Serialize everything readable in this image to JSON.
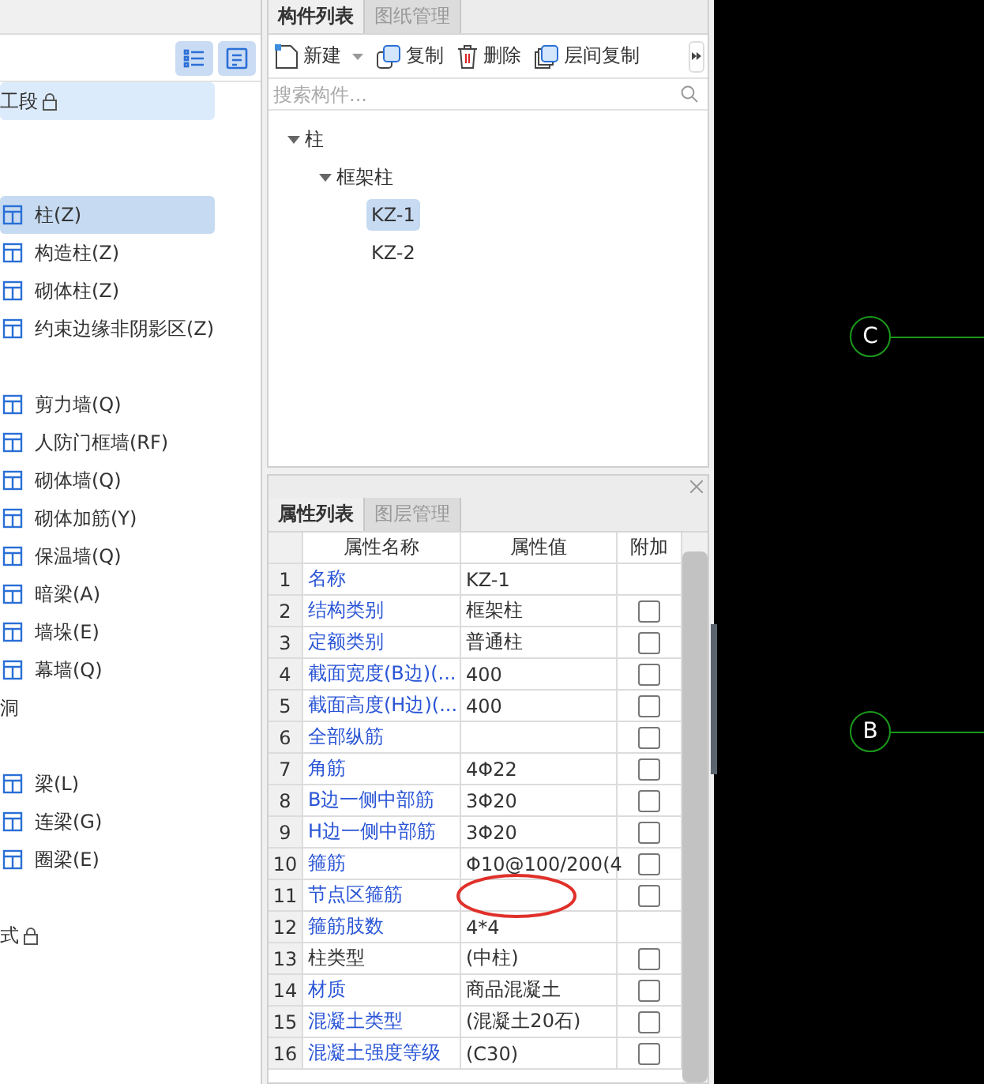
{
  "left": {
    "groups": [
      {
        "header": "工段",
        "locked": true,
        "selected": true
      },
      {
        "items": [
          {
            "label": "柱(Z)",
            "selected": true
          },
          {
            "label": "构造柱(Z)",
            "selected": false
          },
          {
            "label": "砌体柱(Z)",
            "selected": false
          },
          {
            "label": "约束边缘非阴影区(Z)",
            "selected": false
          }
        ]
      },
      {
        "items": [
          {
            "label": "剪力墙(Q)",
            "selected": false
          },
          {
            "label": "人防门框墙(RF)",
            "selected": false
          },
          {
            "label": "砌体墙(Q)",
            "selected": false
          },
          {
            "label": "砌体加筋(Y)",
            "selected": false
          },
          {
            "label": "保温墙(Q)",
            "selected": false
          },
          {
            "label": "暗梁(A)",
            "selected": false
          },
          {
            "label": "墙垛(E)",
            "selected": false
          },
          {
            "label": "幕墙(Q)",
            "selected": false
          }
        ]
      },
      {
        "header": "洞",
        "locked": false,
        "selected": false
      },
      {
        "items": [
          {
            "label": "梁(L)",
            "selected": false
          },
          {
            "label": "连梁(G)",
            "selected": false
          },
          {
            "label": "圈梁(E)",
            "selected": false
          }
        ]
      },
      {
        "header": "式",
        "locked": true,
        "selected": false
      }
    ]
  },
  "component_panel": {
    "tabs": [
      {
        "label": "构件列表",
        "selected": true
      },
      {
        "label": "图纸管理",
        "selected": false
      }
    ],
    "toolbar": [
      {
        "label": "新建",
        "kind": "new"
      },
      {
        "label": "复制",
        "kind": "copy"
      },
      {
        "label": "删除",
        "kind": "delete"
      },
      {
        "label": "层间复制",
        "kind": "floor_copy"
      }
    ],
    "search": {
      "placeholder": "搜索构件..."
    },
    "tree": [
      {
        "label": "柱",
        "expanded": true,
        "selected": false,
        "children": [
          {
            "label": "框架柱",
            "expanded": true,
            "selected": false,
            "children": [
              {
                "label": "KZ-1",
                "selected": true
              },
              {
                "label": "KZ-2",
                "selected": false
              }
            ]
          }
        ]
      }
    ]
  },
  "property_panel": {
    "tabs": [
      {
        "label": "属性列表",
        "selected": true
      },
      {
        "label": "图层管理",
        "selected": false
      }
    ],
    "columns": [
      "属性名称",
      "属性值",
      "附加"
    ],
    "rows": [
      {
        "index": "1",
        "name": "名称",
        "value": "KZ-1",
        "color": "#2a55d6"
      },
      {
        "index": "2",
        "name": "结构类别",
        "value": "框架柱",
        "color": "#2a55d6",
        "checked": false
      },
      {
        "index": "3",
        "name": "定额类别",
        "value": "普通柱",
        "color": "#2a55d6",
        "checked": false
      },
      {
        "index": "4",
        "name": "截面宽度(B边)(...",
        "value": "400",
        "color": "#2a55d6",
        "checked": false
      },
      {
        "index": "5",
        "name": "截面高度(H边)(...",
        "value": "400",
        "color": "#2a55d6",
        "checked": false
      },
      {
        "index": "6",
        "name": "全部纵筋",
        "color": "#2a55d6",
        "checked": false
      },
      {
        "index": "7",
        "name": "角筋",
        "value": "4Φ22",
        "color": "#2a55d6",
        "checked": false
      },
      {
        "index": "8",
        "name": "B边一侧中部筋",
        "value": "3Φ20",
        "color": "#2a55d6",
        "checked": false
      },
      {
        "index": "9",
        "name": "H边一侧中部筋",
        "value": "3Φ20",
        "color": "#2a55d6",
        "checked": false
      },
      {
        "index": "10",
        "name": "箍筋",
        "value": "Φ10@100/200(4",
        "color": "#2a55d6",
        "checked": false
      },
      {
        "index": "11",
        "name": "节点区箍筋",
        "color": "#2a55d6",
        "checked": false,
        "circled": true
      },
      {
        "index": "12",
        "name": "箍筋肢数",
        "value": "4*4",
        "color": "#2a55d6"
      },
      {
        "index": "13",
        "name": "柱类型",
        "value": "(中柱)",
        "color": "#333333",
        "checked": false
      },
      {
        "index": "14",
        "name": "材质",
        "value": "商品混凝土",
        "color": "#2a55d6",
        "checked": false
      },
      {
        "index": "15",
        "name": "混凝土类型",
        "value": "(混凝土20石)",
        "color": "#2a55d6",
        "checked": false
      },
      {
        "index": "16",
        "name": "混凝土强度等级",
        "value": "(C30)",
        "color": "#2a55d6",
        "checked": false
      }
    ]
  },
  "canvas": {
    "axes": [
      {
        "label": "C"
      },
      {
        "label": "B"
      }
    ]
  }
}
